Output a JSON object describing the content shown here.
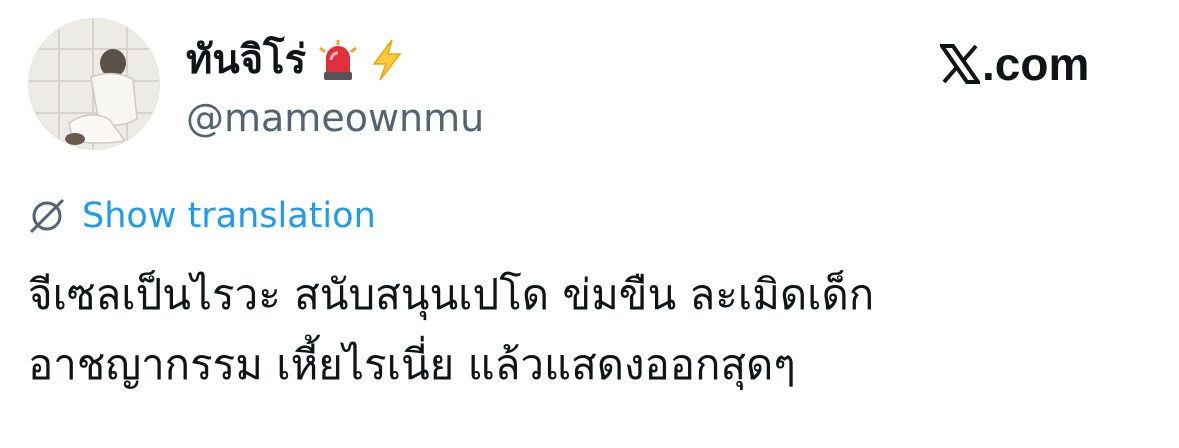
{
  "author": {
    "display_name": "ทันจิโร่",
    "handle": "@mameownmu",
    "badges": [
      "police-light-icon",
      "lightning-icon"
    ]
  },
  "brand": {
    "text": ".com",
    "logo": "x-logo-icon"
  },
  "translation": {
    "link_label": "Show translation",
    "icon": "globe-slash-icon"
  },
  "tweet": {
    "lines": [
      "จีเซลเป็นไรวะ สนับสนุนเปโด ข่มขืน ละเมิดเด็ก",
      "อาชญากรรม เหี้ยไรเนี่ย แล้วแสดงออกสุดๆ"
    ]
  },
  "colors": {
    "link": "#1d9bf0",
    "secondary_text": "#536471",
    "primary_text": "#0f1419"
  }
}
